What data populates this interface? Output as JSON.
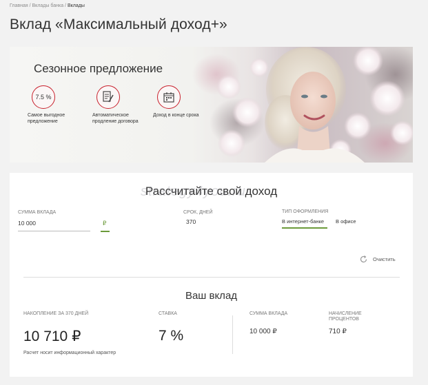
{
  "breadcrumb": {
    "items": [
      "Главная",
      "Вклады банка",
      "Вклады"
    ],
    "separator": "/"
  },
  "page_title": "Вклад «Максимальный доход+»",
  "banner": {
    "heading": "Сезонное предложение",
    "features": [
      {
        "icon": "percent-badge",
        "icon_text": "7.5 %",
        "label": "Самое выгодное предложение"
      },
      {
        "icon": "document-pen-icon",
        "label": "Автоматическое продление договора"
      },
      {
        "icon": "calendar-icon",
        "label": "Доход в конце срока"
      }
    ],
    "accent_color": "#c8202c"
  },
  "calculator": {
    "title": "Рассчитайте свой доход",
    "watermark": "strategy4you.ru",
    "amount_label": "СУММА ВКЛАДА",
    "amount_value": "10 000",
    "currency": "₽",
    "term_label": "СРОК, ДНЕЙ",
    "term_value": "370",
    "type_label": "ТИП ОФОРМЛЕНИЯ",
    "type_options": [
      "В интернет-банке",
      "В офисе"
    ],
    "type_selected": "В интернет-банке",
    "clear_label": "Очистить",
    "accent_color": "#6b9a3a"
  },
  "result": {
    "title": "Ваш вклад",
    "accumulation_label": "НАКОПЛЕНИЕ ЗА 370 ДНЕЙ",
    "accumulation_value": "10 710 ₽",
    "rate_label": "СТАВКА",
    "rate_value": "7 %",
    "note": "Расчет носит информационный характер",
    "deposit_sum_label": "СУММА ВКЛАДА",
    "deposit_sum_value": "10 000 ₽",
    "interest_label_1": "НАЧИСЛЕНИЕ",
    "interest_label_2": "ПРОЦЕНТОВ",
    "interest_value": "710 ₽"
  }
}
